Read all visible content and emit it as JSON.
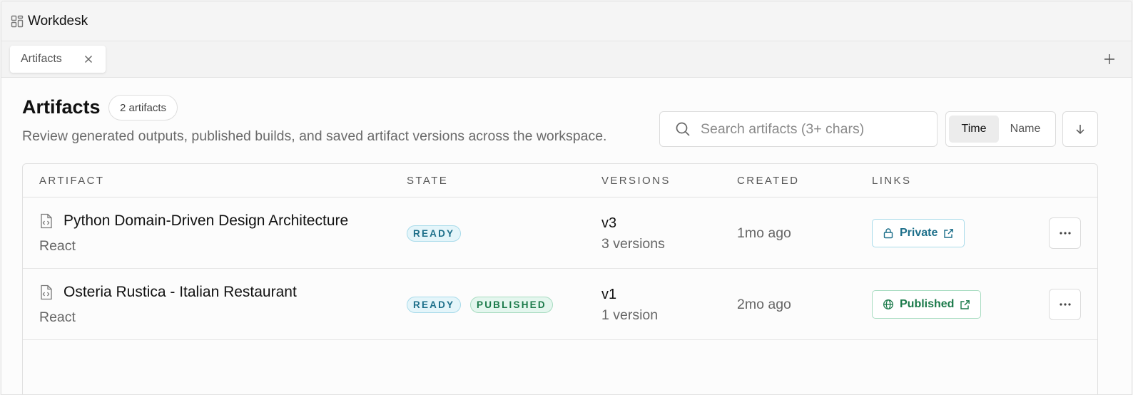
{
  "app": {
    "title": "Workdesk",
    "icon": "grid-icon"
  },
  "tabs": [
    {
      "label": "Artifacts"
    }
  ],
  "header": {
    "title": "Artifacts",
    "count_label": "2 artifacts",
    "subtitle": "Review generated outputs, published builds, and saved artifact versions across the workspace."
  },
  "search": {
    "placeholder": "Search artifacts (3+ chars)",
    "value": ""
  },
  "sort": {
    "options": [
      "Time",
      "Name"
    ],
    "selected": "Time",
    "direction": "descending"
  },
  "table": {
    "columns": [
      "ARTIFACT",
      "STATE",
      "VERSIONS",
      "CREATED",
      "LINKS"
    ],
    "rows": [
      {
        "name": "Python Domain-Driven Design Architecture",
        "framework": "React",
        "badges": [
          "READY"
        ],
        "version": "v3",
        "version_count": "3 versions",
        "created": "1mo ago",
        "link_label": "Private",
        "link_icon": "lock-icon"
      },
      {
        "name": "Osteria Rustica - Italian Restaurant",
        "framework": "React",
        "badges": [
          "READY",
          "PUBLISHED"
        ],
        "version": "v1",
        "version_count": "1 version",
        "created": "2mo ago",
        "link_label": "Published",
        "link_icon": "globe-icon"
      }
    ]
  },
  "colors": {
    "ready_text": "#1d6f8a",
    "ready_bg": "#e4f5fa",
    "published_text": "#1b7a4a",
    "published_bg": "#e4f6ee"
  }
}
